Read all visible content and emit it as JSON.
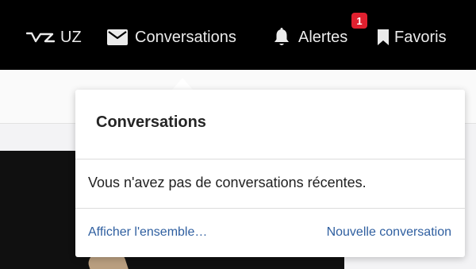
{
  "nav": {
    "uz_label": "UZ",
    "conversations_label": "Conversations",
    "alerts_label": "Alertes",
    "alerts_count": "1",
    "favorites_label": "Favoris"
  },
  "icons": {
    "logo": "uz-logo-icon",
    "conversations": "envelope-icon",
    "alerts": "bell-icon",
    "favorites": "bookmark-icon"
  },
  "popup": {
    "title": "Conversations",
    "empty_message": "Vous n'avez pas de conversations récentes.",
    "show_all_link": "Afficher l'ensemble…",
    "new_conversation_link": "Nouvelle conversation"
  },
  "colors": {
    "topbar": "#000000",
    "badge": "#e0202f",
    "link": "#2f5fa0"
  }
}
